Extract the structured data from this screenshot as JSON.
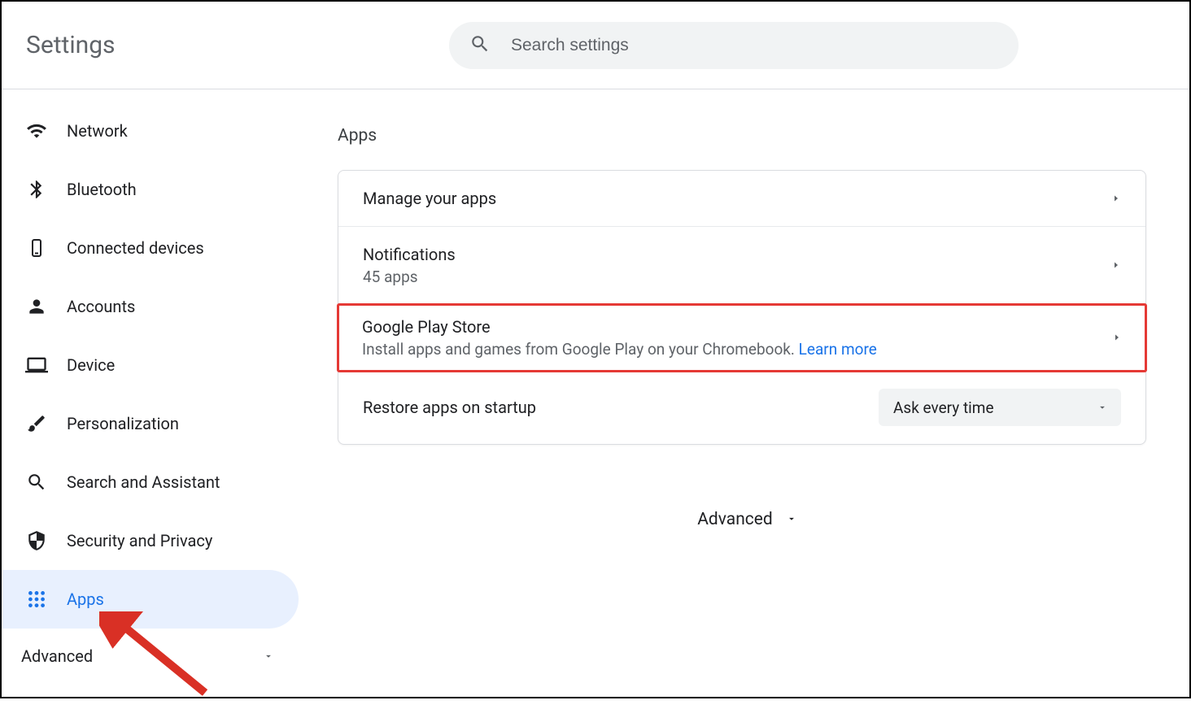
{
  "header": {
    "title": "Settings",
    "search_placeholder": "Search settings"
  },
  "sidebar": {
    "items": [
      {
        "label": "Network",
        "icon": "wifi"
      },
      {
        "label": "Bluetooth",
        "icon": "bluetooth"
      },
      {
        "label": "Connected devices",
        "icon": "phone"
      },
      {
        "label": "Accounts",
        "icon": "person"
      },
      {
        "label": "Device",
        "icon": "laptop"
      },
      {
        "label": "Personalization",
        "icon": "brush"
      },
      {
        "label": "Search and Assistant",
        "icon": "search"
      },
      {
        "label": "Security and Privacy",
        "icon": "shield"
      },
      {
        "label": "Apps",
        "icon": "apps",
        "active": true
      }
    ],
    "advanced_label": "Advanced"
  },
  "main": {
    "section_title": "Apps",
    "rows": {
      "manage": "Manage your apps",
      "notifications_label": "Notifications",
      "notifications_sub": "45 apps",
      "play_label": "Google Play Store",
      "play_sub": "Install apps and games from Google Play on your Chromebook. ",
      "play_link": "Learn more",
      "restore_label": "Restore apps on startup",
      "restore_value": "Ask every time"
    },
    "advanced_label": "Advanced"
  }
}
